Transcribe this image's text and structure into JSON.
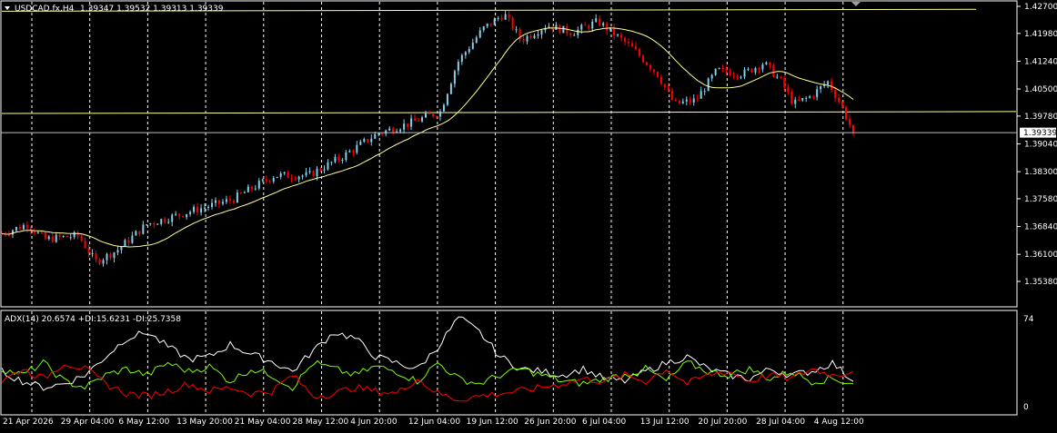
{
  "main": {
    "symbol": "USDCAD.fx,H4",
    "ohlc_text": "1.39347 1.39532 1.39313 1.39339",
    "current_price": "1.39339",
    "price_ticks": [
      "1.42700",
      "1.41980",
      "1.41240",
      "1.40500",
      "1.39780",
      "1.39040",
      "1.38300",
      "1.37580",
      "1.36840",
      "1.36100",
      "1.35380"
    ],
    "time_labels": [
      "21 Apr 2026",
      "29 Apr 04:00",
      "6 May 12:00",
      "13 May 20:00",
      "21 May 04:00",
      "28 May 12:00",
      "4 Jun 20:00",
      "12 Jun 04:00",
      "19 Jun 12:00",
      "26 Jun 20:00",
      "6 Jul 04:00",
      "13 Jul 12:00",
      "20 Jul 20:00",
      "28 Jul 04:00",
      "4 Aug 12:00"
    ]
  },
  "indicator": {
    "label": "ADX(14) 20.6574 +DI:15.6231 -DI:25.7358",
    "scale_max": "74",
    "scale_min": "0"
  },
  "colors": {
    "background": "#000000",
    "bull_candle": "#87ceeb",
    "bear_candle": "#ff0000",
    "moving_average": "#ffff99",
    "level_lines": "#ffff99",
    "grid": "#ffffff",
    "adx_line": "#ffffff",
    "plus_di": "#7cfc00",
    "minus_di": "#ff0000"
  },
  "chart_data": [
    {
      "type": "candlestick",
      "title": "USDCAD.fx,H4",
      "ylim": [
        1.3538,
        1.427
      ],
      "close_waypoints": [
        {
          "t": 0,
          "v": 1.3665
        },
        {
          "t": 0.03,
          "v": 1.369
        },
        {
          "t": 0.05,
          "v": 1.365
        },
        {
          "t": 0.09,
          "v": 1.366
        },
        {
          "t": 0.11,
          "v": 1.359
        },
        {
          "t": 0.135,
          "v": 1.362
        },
        {
          "t": 0.17,
          "v": 1.369
        },
        {
          "t": 0.23,
          "v": 1.373
        },
        {
          "t": 0.27,
          "v": 1.3755
        },
        {
          "t": 0.32,
          "v": 1.382
        },
        {
          "t": 0.36,
          "v": 1.382
        },
        {
          "t": 0.4,
          "v": 1.387
        },
        {
          "t": 0.44,
          "v": 1.393
        },
        {
          "t": 0.48,
          "v": 1.396
        },
        {
          "t": 0.515,
          "v": 1.399
        },
        {
          "t": 0.535,
          "v": 1.412
        },
        {
          "t": 0.565,
          "v": 1.421
        },
        {
          "t": 0.59,
          "v": 1.425
        },
        {
          "t": 0.61,
          "v": 1.418
        },
        {
          "t": 0.64,
          "v": 1.422
        },
        {
          "t": 0.67,
          "v": 1.42
        },
        {
          "t": 0.7,
          "v": 1.423
        },
        {
          "t": 0.74,
          "v": 1.416
        },
        {
          "t": 0.77,
          "v": 1.409
        },
        {
          "t": 0.79,
          "v": 1.401
        },
        {
          "t": 0.815,
          "v": 1.402
        },
        {
          "t": 0.84,
          "v": 1.41
        },
        {
          "t": 0.87,
          "v": 1.409
        },
        {
          "t": 0.895,
          "v": 1.412
        },
        {
          "t": 0.915,
          "v": 1.407
        },
        {
          "t": 0.93,
          "v": 1.401
        },
        {
          "t": 0.95,
          "v": 1.403
        },
        {
          "t": 0.97,
          "v": 1.407
        },
        {
          "t": 0.985,
          "v": 1.401
        },
        {
          "t": 1,
          "v": 1.3934
        }
      ],
      "horizontal_levels": [
        {
          "left_value": 1.4257,
          "right_value": 1.4262
        },
        {
          "left_value": 1.3985,
          "right_value": 1.399
        }
      ]
    },
    {
      "type": "line",
      "title": "ADX(14)",
      "ylim": [
        0,
        74
      ],
      "series": [
        {
          "name": "ADX",
          "values": [
            28,
            20,
            15,
            18,
            25,
            40,
            55,
            60,
            48,
            38,
            40,
            50,
            42,
            36,
            28,
            45,
            60,
            55,
            40,
            35,
            30,
            48,
            72,
            60,
            40,
            30,
            28,
            25,
            30,
            22,
            20,
            28,
            35,
            40,
            30,
            25,
            22,
            30,
            25,
            28,
            35,
            20
          ]
        },
        {
          "name": "+DI",
          "values": [
            30,
            25,
            35,
            20,
            15,
            25,
            30,
            25,
            35,
            28,
            32,
            20,
            30,
            25,
            15,
            35,
            30,
            25,
            32,
            28,
            20,
            35,
            22,
            18,
            25,
            30,
            25,
            20,
            18,
            22,
            25,
            30,
            20,
            35,
            28,
            25,
            30,
            22,
            28,
            20,
            22,
            18
          ]
        },
        {
          "name": "-DI",
          "values": [
            20,
            30,
            22,
            35,
            30,
            18,
            10,
            8,
            12,
            18,
            12,
            15,
            10,
            12,
            25,
            8,
            10,
            15,
            12,
            10,
            22,
            10,
            5,
            8,
            10,
            12,
            15,
            18,
            22,
            20,
            25,
            20,
            30,
            18,
            25,
            28,
            20,
            25,
            22,
            30,
            25,
            28
          ]
        }
      ]
    }
  ]
}
